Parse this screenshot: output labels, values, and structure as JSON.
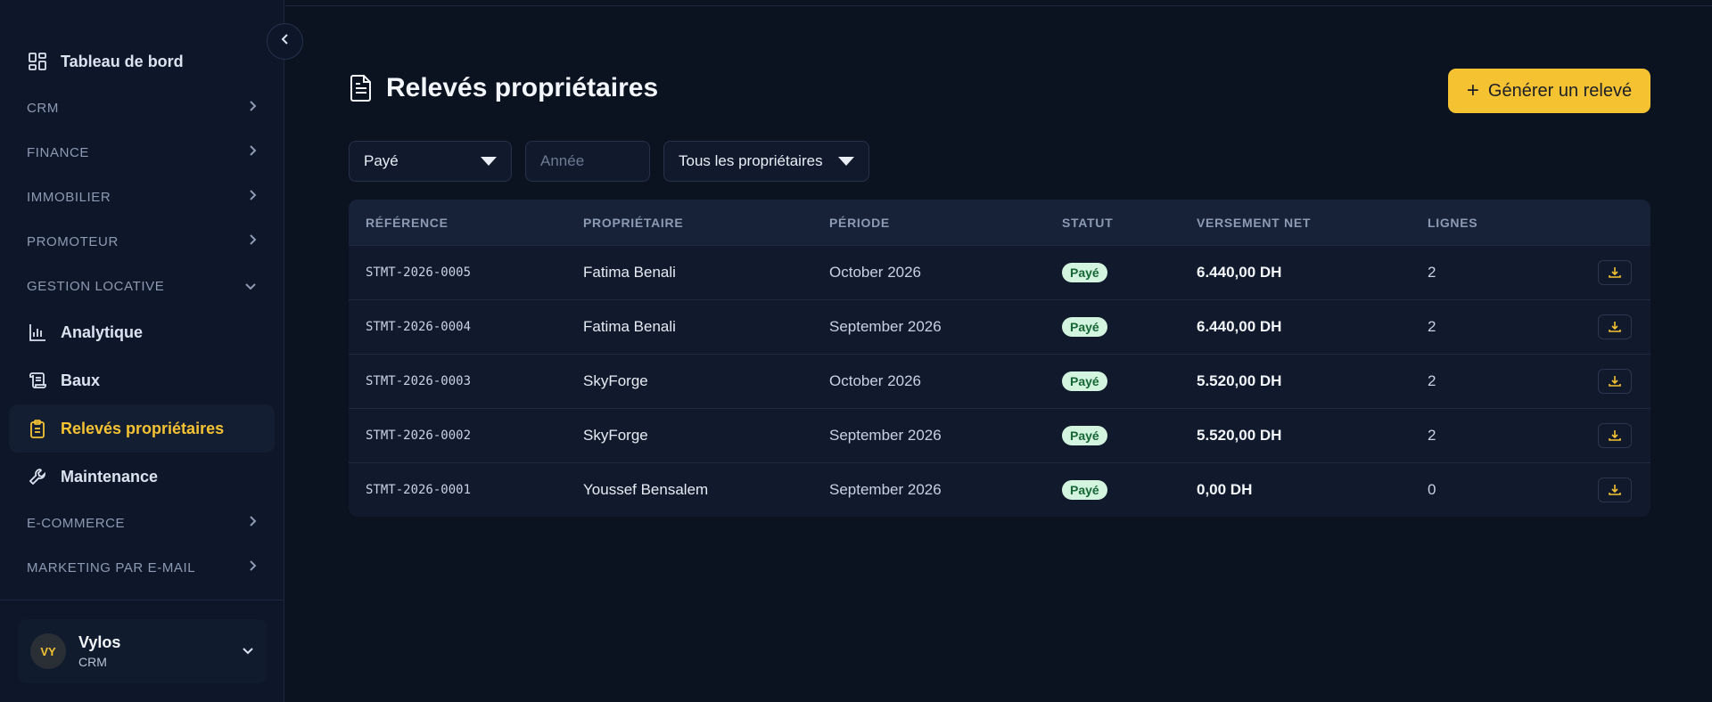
{
  "sidebar": {
    "top_item": {
      "label": "Tableau de bord",
      "icon": "dashboard-icon"
    },
    "sections": {
      "crm": "CRM",
      "finance": "FINANCE",
      "immobilier": "IMMOBILIER",
      "promoteur": "PROMOTEUR",
      "gestion": "GESTION LOCATIVE",
      "ecommerce": "E-COMMERCE",
      "marketing": "MARKETING PAR E-MAIL"
    },
    "sub_items": [
      {
        "label": "Analytique",
        "icon": "chart-icon"
      },
      {
        "label": "Baux",
        "icon": "scroll-icon"
      },
      {
        "label": "Relevés propriétaires",
        "icon": "clipboard-icon",
        "active": true
      },
      {
        "label": "Maintenance",
        "icon": "wrench-icon"
      }
    ],
    "user": {
      "initials": "VY",
      "name": "Vylos",
      "role": "CRM"
    }
  },
  "page": {
    "title": "Relevés propriétaires",
    "generate_label": "Générer un relevé"
  },
  "filters": {
    "status_value": "Payé",
    "year_placeholder": "Année",
    "owner_value": "Tous les propriétaires"
  },
  "table": {
    "headers": {
      "reference": "RÉFÉRENCE",
      "owner": "PROPRIÉTAIRE",
      "period": "PÉRIODE",
      "status": "STATUT",
      "net": "VERSEMENT NET",
      "lines": "LIGNES"
    },
    "rows": [
      {
        "reference": "STMT-2026-0005",
        "owner": "Fatima Benali",
        "period": "October 2026",
        "status": "Payé",
        "net": "6.440,00 DH",
        "lines": "2"
      },
      {
        "reference": "STMT-2026-0004",
        "owner": "Fatima Benali",
        "period": "September 2026",
        "status": "Payé",
        "net": "6.440,00 DH",
        "lines": "2"
      },
      {
        "reference": "STMT-2026-0003",
        "owner": "SkyForge",
        "period": "October 2026",
        "status": "Payé",
        "net": "5.520,00 DH",
        "lines": "2"
      },
      {
        "reference": "STMT-2026-0002",
        "owner": "SkyForge",
        "period": "September 2026",
        "status": "Payé",
        "net": "5.520,00 DH",
        "lines": "2"
      },
      {
        "reference": "STMT-2026-0001",
        "owner": "Youssef Bensalem",
        "period": "September 2026",
        "status": "Payé",
        "net": "0,00 DH",
        "lines": "0"
      }
    ]
  },
  "colors": {
    "accent": "#f5c232",
    "background": "#0b1220",
    "sidebar": "#0e1729",
    "badge_bg": "#d3f5df",
    "badge_text": "#166534"
  }
}
